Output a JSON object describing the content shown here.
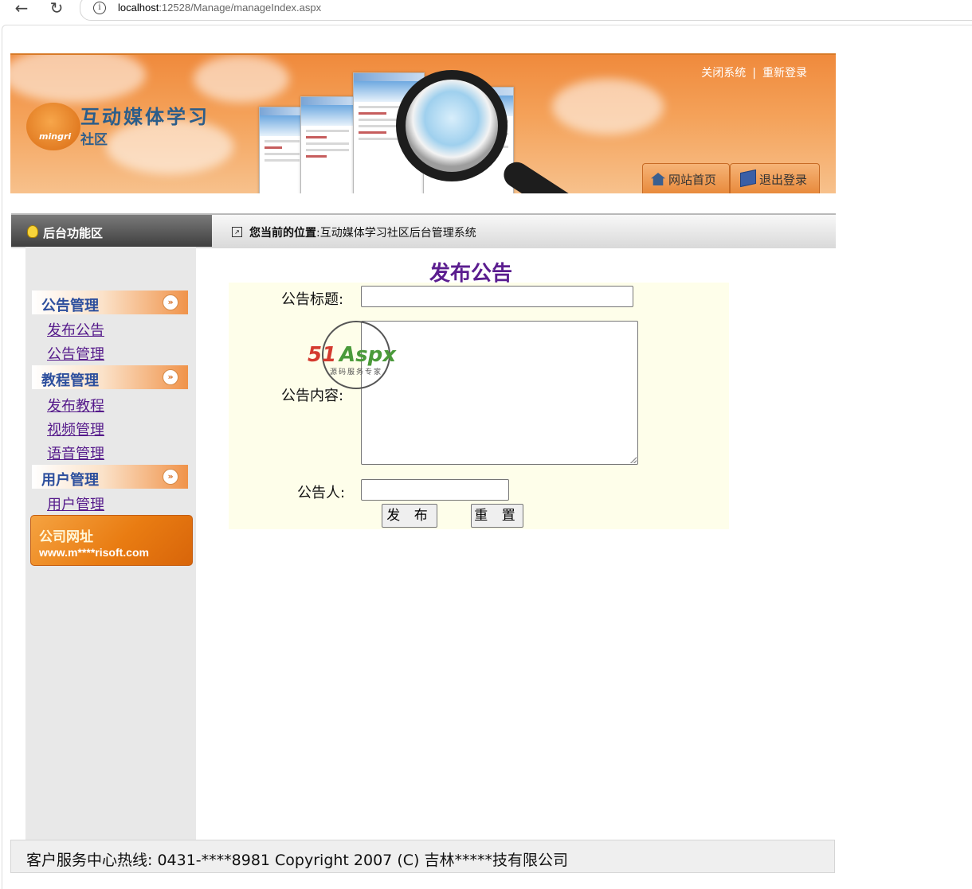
{
  "browser": {
    "url_host": "localhost",
    "url_rest": ":12528/Manage/manageIndex.aspx",
    "back_icon": "←",
    "reload_icon": "↻",
    "info_icon": "i"
  },
  "banner": {
    "logo_brand": "mingri",
    "logo_title": "互动媒体学习",
    "logo_subtitle": "社区",
    "close_system": "关闭系统",
    "separator": "|",
    "relogin": "重新登录",
    "home_tab": "网站首页",
    "logout_tab": "退出登录"
  },
  "navbar": {
    "left_label": "后台功能区",
    "position_prefix": "您当前的位置",
    "position_value": ":互动媒体学习社区后台管理系统"
  },
  "sidebar": {
    "sections": [
      {
        "title": "公告管理",
        "links": [
          "发布公告",
          "公告管理"
        ]
      },
      {
        "title": "教程管理",
        "links": [
          "发布教程",
          "视频管理",
          "语音管理"
        ]
      },
      {
        "title": "用户管理",
        "links": [
          "用户管理"
        ]
      }
    ],
    "chevron": "»",
    "ad_title": "公司网址",
    "ad_url": "www.m****risoft.com"
  },
  "form": {
    "title": "发布公告",
    "title_label": "公告标题:",
    "title_value": "",
    "content_label": "公告内容:",
    "content_value": "",
    "author_label": "公告人:",
    "author_value": "",
    "submit_label": "发 布",
    "reset_label": "重 置"
  },
  "watermark": {
    "part1": "51",
    "part2": "Aspx",
    "caption": "源码服务专家"
  },
  "footer": {
    "text": "客户服务中心热线: 0431-****8981 Copyright 2007 (C) 吉林*****技有限公司"
  }
}
